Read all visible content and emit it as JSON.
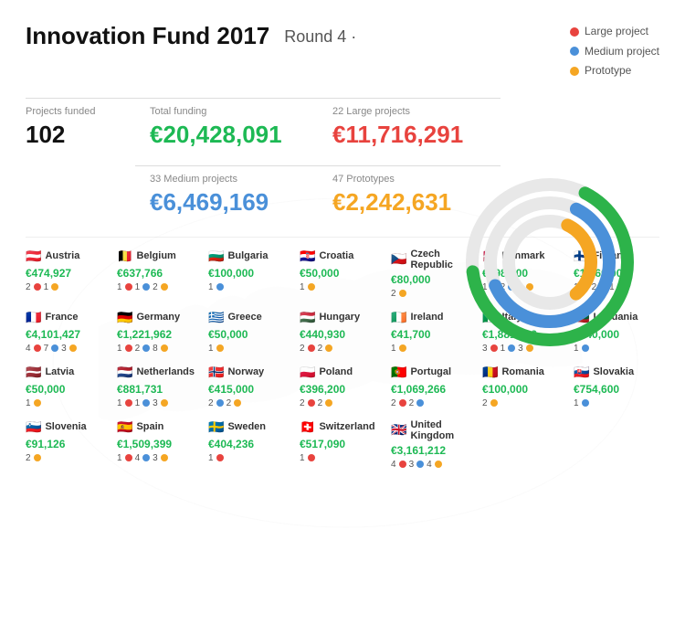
{
  "header": {
    "title": "Innovation Fund 2017",
    "round": "Round 4 ·"
  },
  "legend": {
    "items": [
      {
        "label": "Large project",
        "color": "#e8433e"
      },
      {
        "label": "Medium project",
        "color": "#4a90d9"
      },
      {
        "label": "Prototype",
        "color": "#f5a623"
      }
    ]
  },
  "stats": {
    "projects_funded_label": "Projects funded",
    "projects_funded_value": "102",
    "total_funding_label": "Total funding",
    "total_funding_value": "€20,428,091",
    "large_projects_label": "22 Large projects",
    "large_projects_value": "€11,716,291",
    "medium_projects_label": "33 Medium projects",
    "medium_projects_value": "€6,469,169",
    "prototypes_label": "47 Prototypes",
    "prototypes_value": "€2,242,631"
  },
  "donut": {
    "green_stroke": 200,
    "blue_stroke": 140,
    "yellow_stroke": 60
  },
  "countries": [
    {
      "name": "Austria",
      "flag": "🇦🇹",
      "amount": "€474,927",
      "projects": [
        {
          "n": 2,
          "type": "large"
        },
        {
          "n": 1,
          "type": "prototype"
        }
      ]
    },
    {
      "name": "Belgium",
      "flag": "🇧🇪",
      "amount": "€637,766",
      "projects": [
        {
          "n": 1,
          "type": "large"
        },
        {
          "n": 1,
          "type": "medium"
        },
        {
          "n": 2,
          "type": "prototype"
        }
      ]
    },
    {
      "name": "Bulgaria",
      "flag": "🇧🇬",
      "amount": "€100,000",
      "projects": [
        {
          "n": 1,
          "type": "medium"
        }
      ]
    },
    {
      "name": "Croatia",
      "flag": "🇭🇷",
      "amount": "€50,000",
      "projects": [
        {
          "n": 1,
          "type": "prototype"
        }
      ]
    },
    {
      "name": "Czech Republic",
      "flag": "🇨🇿",
      "amount": "€80,000",
      "projects": [
        {
          "n": 2,
          "type": "prototype"
        }
      ]
    },
    {
      "name": "Denmark",
      "flag": "🇩🇰",
      "amount": "€798,000",
      "projects": [
        {
          "n": 1,
          "type": "large"
        },
        {
          "n": 2,
          "type": "medium"
        },
        {
          "n": 1,
          "type": "prototype"
        }
      ]
    },
    {
      "name": "Finland",
      "flag": "🇫🇮",
      "amount": "€1,060,000",
      "projects": [
        {
          "n": 1,
          "type": "large"
        },
        {
          "n": 2,
          "type": "medium"
        },
        {
          "n": 1,
          "type": "prototype"
        }
      ]
    },
    {
      "name": "France",
      "flag": "🇫🇷",
      "amount": "€4,101,427",
      "projects": [
        {
          "n": 4,
          "type": "large"
        },
        {
          "n": 7,
          "type": "medium"
        },
        {
          "n": 3,
          "type": "prototype"
        }
      ]
    },
    {
      "name": "Germany",
      "flag": "🇩🇪",
      "amount": "€1,221,962",
      "projects": [
        {
          "n": 1,
          "type": "large"
        },
        {
          "n": 2,
          "type": "medium"
        },
        {
          "n": 8,
          "type": "prototype"
        }
      ]
    },
    {
      "name": "Greece",
      "flag": "🇬🇷",
      "amount": "€50,000",
      "projects": [
        {
          "n": 1,
          "type": "prototype"
        }
      ]
    },
    {
      "name": "Hungary",
      "flag": "🇭🇺",
      "amount": "€440,930",
      "projects": [
        {
          "n": 2,
          "type": "large"
        },
        {
          "n": 2,
          "type": "prototype"
        }
      ]
    },
    {
      "name": "Ireland",
      "flag": "🇮🇪",
      "amount": "€41,700",
      "projects": [
        {
          "n": 1,
          "type": "prototype"
        }
      ]
    },
    {
      "name": "Italy",
      "flag": "🇮🇹",
      "amount": "€1,881,519",
      "projects": [
        {
          "n": 3,
          "type": "large"
        },
        {
          "n": 1,
          "type": "medium"
        },
        {
          "n": 3,
          "type": "prototype"
        }
      ]
    },
    {
      "name": "Lithuania",
      "flag": "🇱🇹",
      "amount": "€140,000",
      "projects": [
        {
          "n": 1,
          "type": "medium"
        }
      ]
    },
    {
      "name": "Latvia",
      "flag": "🇱🇻",
      "amount": "€50,000",
      "projects": [
        {
          "n": 1,
          "type": "prototype"
        }
      ]
    },
    {
      "name": "Netherlands",
      "flag": "🇳🇱",
      "amount": "€881,731",
      "projects": [
        {
          "n": 1,
          "type": "large"
        },
        {
          "n": 1,
          "type": "medium"
        },
        {
          "n": 3,
          "type": "prototype"
        }
      ]
    },
    {
      "name": "Norway",
      "flag": "🇳🇴",
      "amount": "€415,000",
      "projects": [
        {
          "n": 2,
          "type": "medium"
        },
        {
          "n": 2,
          "type": "prototype"
        }
      ]
    },
    {
      "name": "Poland",
      "flag": "🇵🇱",
      "amount": "€396,200",
      "projects": [
        {
          "n": 2,
          "type": "large"
        },
        {
          "n": 2,
          "type": "prototype"
        }
      ]
    },
    {
      "name": "Portugal",
      "flag": "🇵🇹",
      "amount": "€1,069,266",
      "projects": [
        {
          "n": 2,
          "type": "large"
        },
        {
          "n": 2,
          "type": "medium"
        }
      ]
    },
    {
      "name": "Romania",
      "flag": "🇷🇴",
      "amount": "€100,000",
      "projects": [
        {
          "n": 2,
          "type": "prototype"
        }
      ]
    },
    {
      "name": "Slovakia",
      "flag": "🇸🇰",
      "amount": "€754,600",
      "projects": [
        {
          "n": 1,
          "type": "medium"
        }
      ]
    },
    {
      "name": "Slovenia",
      "flag": "🇸🇮",
      "amount": "€91,126",
      "projects": [
        {
          "n": 2,
          "type": "prototype"
        }
      ]
    },
    {
      "name": "Spain",
      "flag": "🇪🇸",
      "amount": "€1,509,399",
      "projects": [
        {
          "n": 1,
          "type": "large"
        },
        {
          "n": 4,
          "type": "medium"
        },
        {
          "n": 3,
          "type": "prototype"
        }
      ]
    },
    {
      "name": "Sweden",
      "flag": "🇸🇪",
      "amount": "€404,236",
      "projects": [
        {
          "n": 1,
          "type": "large"
        }
      ]
    },
    {
      "name": "Switzerland",
      "flag": "🇨🇭",
      "amount": "€517,090",
      "projects": [
        {
          "n": 1,
          "type": "large"
        }
      ]
    },
    {
      "name": "United Kingdom",
      "flag": "🇬🇧",
      "amount": "€3,161,212",
      "projects": [
        {
          "n": 4,
          "type": "large"
        },
        {
          "n": 3,
          "type": "medium"
        },
        {
          "n": 4,
          "type": "prototype"
        }
      ]
    }
  ],
  "colors": {
    "large": "#e8433e",
    "medium": "#4a90d9",
    "prototype": "#f5a623",
    "green": "#1db954"
  }
}
